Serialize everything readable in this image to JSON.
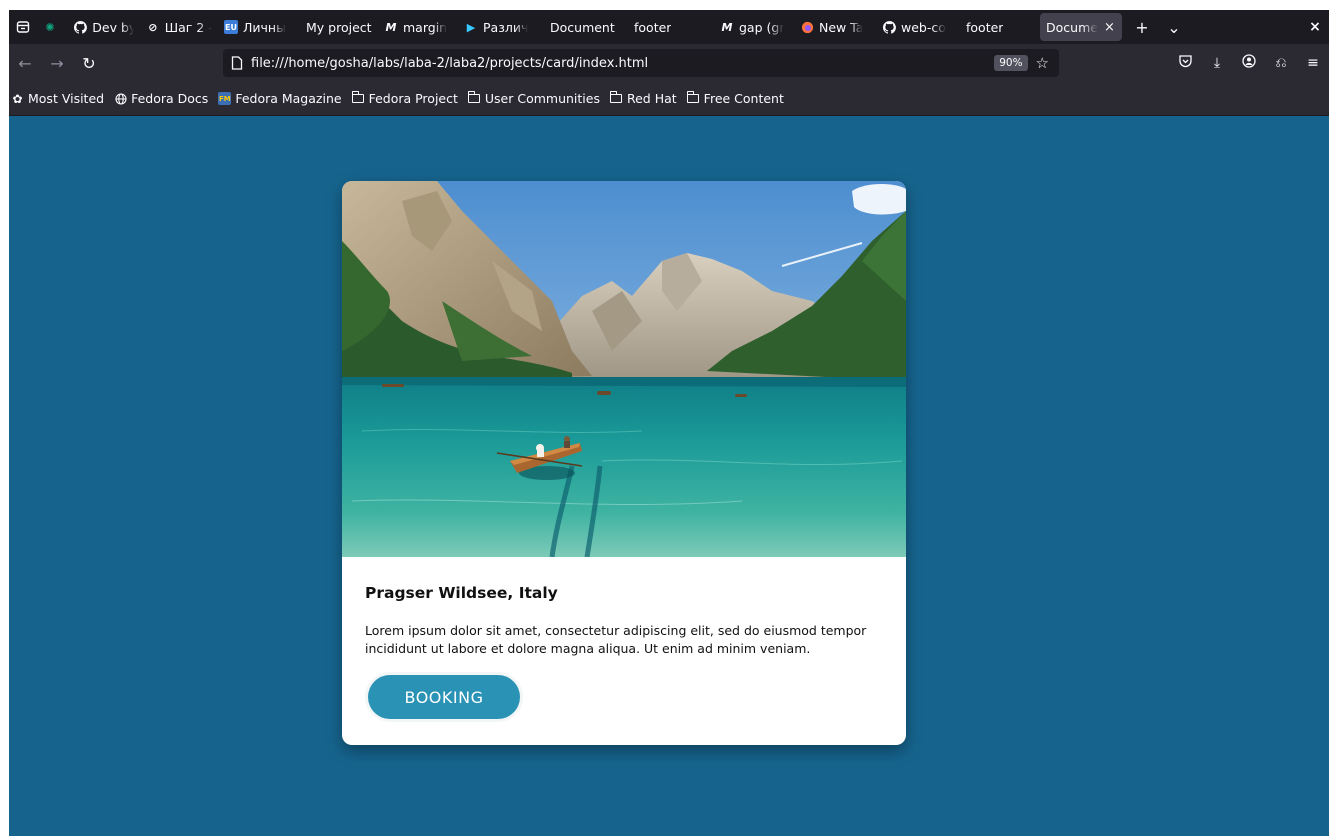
{
  "tabstrip": {
    "tabs": [
      {
        "title": "",
        "favicon": "openai-icon"
      },
      {
        "title": "Dev by",
        "favicon": "github-icon"
      },
      {
        "title": "Шаг 2 -",
        "favicon": "link-icon"
      },
      {
        "title": "Личны",
        "favicon": "eu-icon"
      },
      {
        "title": "My project",
        "favicon": ""
      },
      {
        "title": "margin",
        "favicon": "mdn-icon"
      },
      {
        "title": "Различ",
        "favicon": "play-icon"
      },
      {
        "title": "Document",
        "favicon": ""
      },
      {
        "title": "footer",
        "favicon": ""
      },
      {
        "title": "gap (gr",
        "favicon": "mdn-icon"
      },
      {
        "title": "New Ta",
        "favicon": "firefox-icon"
      },
      {
        "title": "web-co",
        "favicon": "github-icon"
      },
      {
        "title": "footer",
        "favicon": ""
      },
      {
        "title": "Docume",
        "favicon": "",
        "active": true
      }
    ],
    "new_tab": "+",
    "list_all": "⌄",
    "close": "×"
  },
  "navbar": {
    "url": "file:///home/gosha/labs/laba-2/laba2/projects/card/index.html",
    "zoom": "90%"
  },
  "bookmarks": [
    {
      "label": "Most Visited",
      "icon": "gear-icon"
    },
    {
      "label": "Fedora Docs",
      "icon": "globe-icon"
    },
    {
      "label": "Fedora Magazine",
      "icon": "fedora-magazine-icon"
    },
    {
      "label": "Fedora Project",
      "icon": "folder-icon"
    },
    {
      "label": "User Communities",
      "icon": "folder-icon"
    },
    {
      "label": "Red Hat",
      "icon": "folder-icon"
    },
    {
      "label": "Free Content",
      "icon": "folder-icon"
    }
  ],
  "card": {
    "title": "Pragser Wildsee, Italy",
    "text": "Lorem ipsum dolor sit amet, consectetur adipiscing elit, sed do eiusmod tempor incididunt ut labore et dolore magna aliqua. Ut enim ad minim veniam.",
    "button_label": "BOOKING"
  },
  "colors": {
    "page_background": "#16648e",
    "button": "#2a93b5",
    "card": "#ffffff",
    "browser_chrome": "#2b2a33"
  }
}
